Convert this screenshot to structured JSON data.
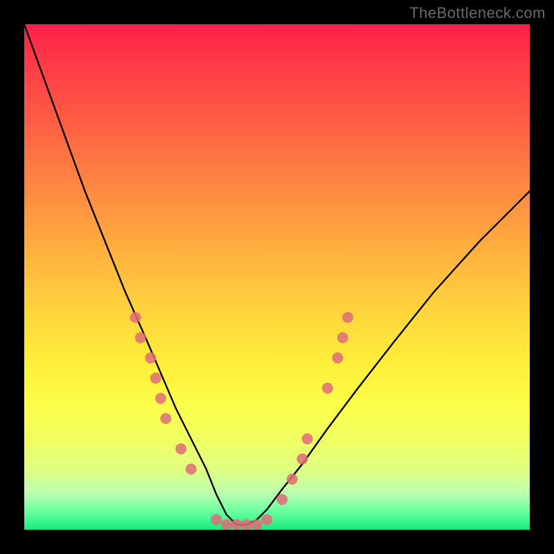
{
  "watermark": "TheBottleneck.com",
  "colors": {
    "background": "#000000",
    "curve": "#000000",
    "marker": "#e06c78",
    "gradient_top": "#ff1f4a",
    "gradient_bottom": "#19e87e"
  },
  "chart_data": {
    "type": "line",
    "title": "",
    "xlabel": "",
    "ylabel": "",
    "xlim": [
      0,
      100
    ],
    "ylim": [
      0,
      100
    ],
    "grid": false,
    "note": "Axes are unlabeled in the image; x/y values are normalized 0–100 estimates from pixel positions. y≈100 at top, y≈0 at bottom (green). Curve is a V-shape with minimum near x≈42.",
    "series": [
      {
        "name": "bottleneck-curve",
        "x": [
          0,
          4,
          8,
          12,
          16,
          20,
          24,
          27,
          30,
          33,
          36,
          38,
          40,
          42,
          44,
          46,
          48,
          51,
          55,
          60,
          66,
          73,
          81,
          90,
          100
        ],
        "y": [
          100,
          89,
          78,
          67,
          57,
          47,
          38,
          31,
          24,
          18,
          12,
          7,
          3,
          1,
          1,
          2,
          4,
          8,
          13,
          20,
          28,
          37,
          47,
          57,
          67
        ]
      }
    ],
    "markers": {
      "name": "highlight-dots",
      "note": "Pink dots clustered along both branches near the bottom and across the trough.",
      "points": [
        {
          "x": 22,
          "y": 42
        },
        {
          "x": 23,
          "y": 38
        },
        {
          "x": 25,
          "y": 34
        },
        {
          "x": 26,
          "y": 30
        },
        {
          "x": 27,
          "y": 26
        },
        {
          "x": 28,
          "y": 22
        },
        {
          "x": 31,
          "y": 16
        },
        {
          "x": 33,
          "y": 12
        },
        {
          "x": 38,
          "y": 2
        },
        {
          "x": 40,
          "y": 1
        },
        {
          "x": 42,
          "y": 1
        },
        {
          "x": 44,
          "y": 1
        },
        {
          "x": 46,
          "y": 1
        },
        {
          "x": 48,
          "y": 2
        },
        {
          "x": 51,
          "y": 6
        },
        {
          "x": 53,
          "y": 10
        },
        {
          "x": 55,
          "y": 14
        },
        {
          "x": 56,
          "y": 18
        },
        {
          "x": 60,
          "y": 28
        },
        {
          "x": 62,
          "y": 34
        },
        {
          "x": 63,
          "y": 38
        },
        {
          "x": 64,
          "y": 42
        }
      ]
    }
  }
}
